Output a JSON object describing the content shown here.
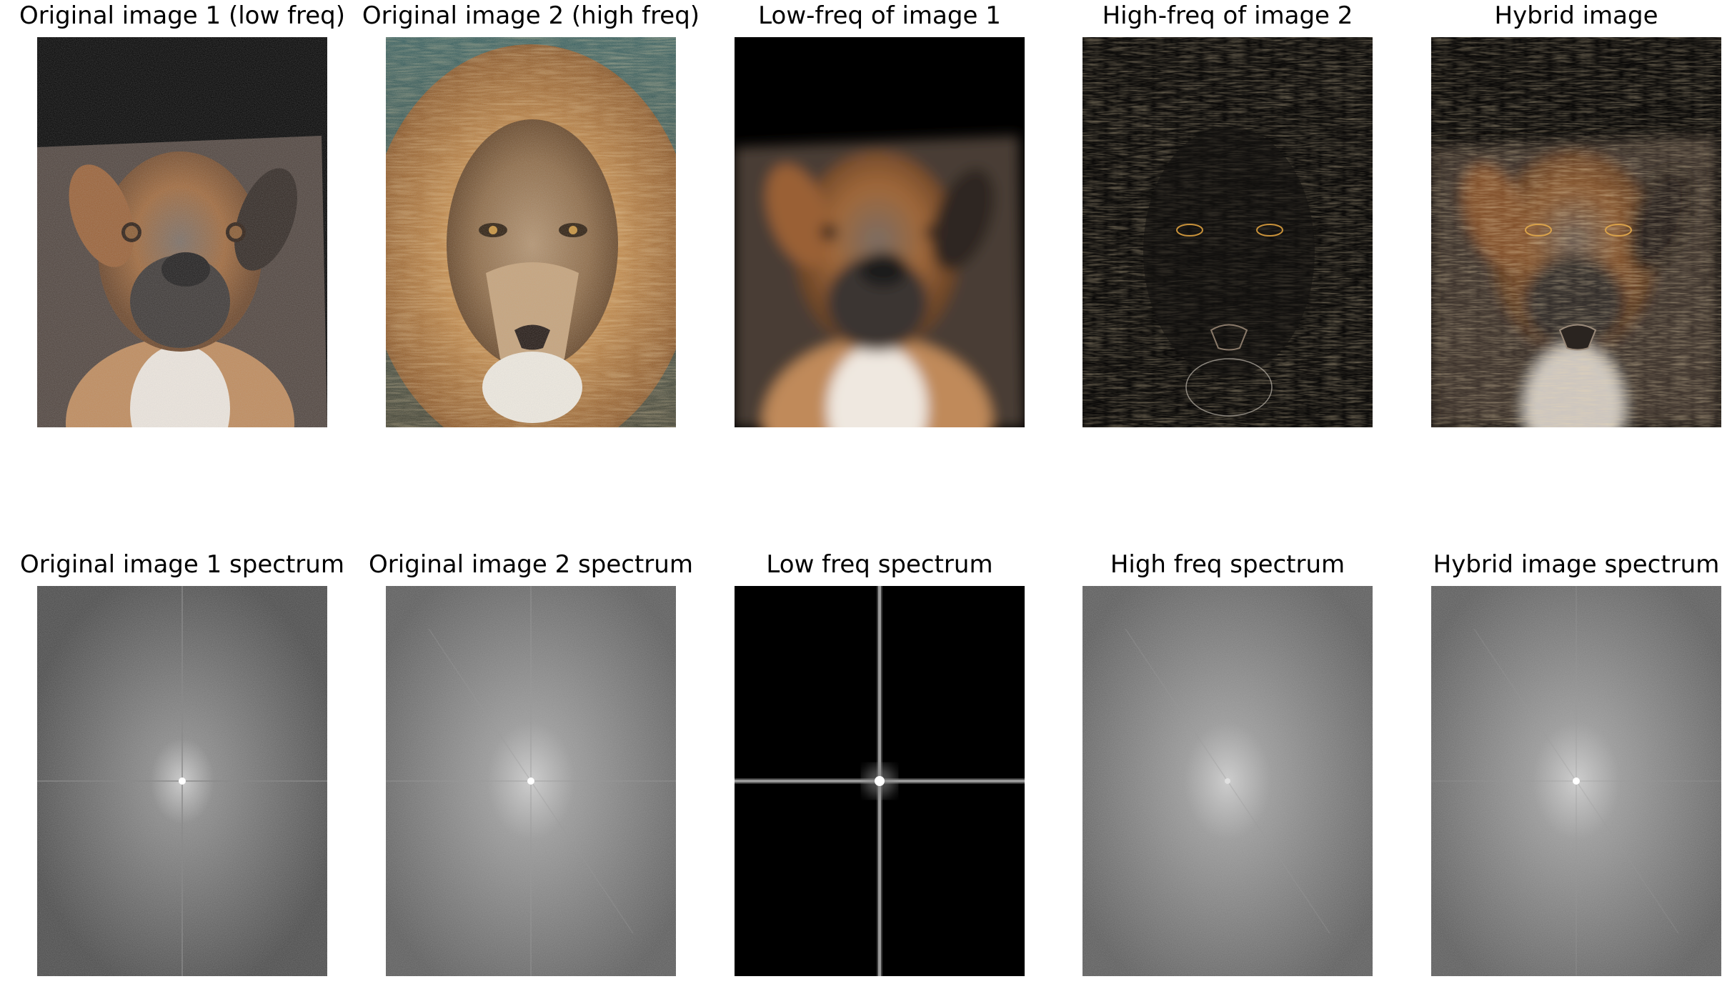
{
  "figure": {
    "row1": [
      {
        "title": "Original image 1 (low freq)",
        "image": "boxer-dog-photo"
      },
      {
        "title": "Original image 2 (high freq)",
        "image": "lion-photo"
      },
      {
        "title": "Low-freq of image 1",
        "image": "blurred-boxer-dog"
      },
      {
        "title": "High-freq of image 2",
        "image": "lion-edge-detail"
      },
      {
        "title": "Hybrid image",
        "image": "hybrid-lion-dog"
      }
    ],
    "row2": [
      {
        "title": "Original image 1 spectrum",
        "image": "fft-magnitude-spectrum"
      },
      {
        "title": "Original image 2 spectrum",
        "image": "fft-magnitude-spectrum"
      },
      {
        "title": "Low freq spectrum",
        "image": "lowpass-spectrum-cross"
      },
      {
        "title": "High freq spectrum",
        "image": "highpass-spectrum"
      },
      {
        "title": "Hybrid image spectrum",
        "image": "fft-magnitude-spectrum"
      }
    ]
  },
  "colors": {
    "background": "#ffffff",
    "dog_fur": "#b8733a",
    "lion_mane": "#c98a3e",
    "spectrum_gray": "#5a5a5a"
  }
}
